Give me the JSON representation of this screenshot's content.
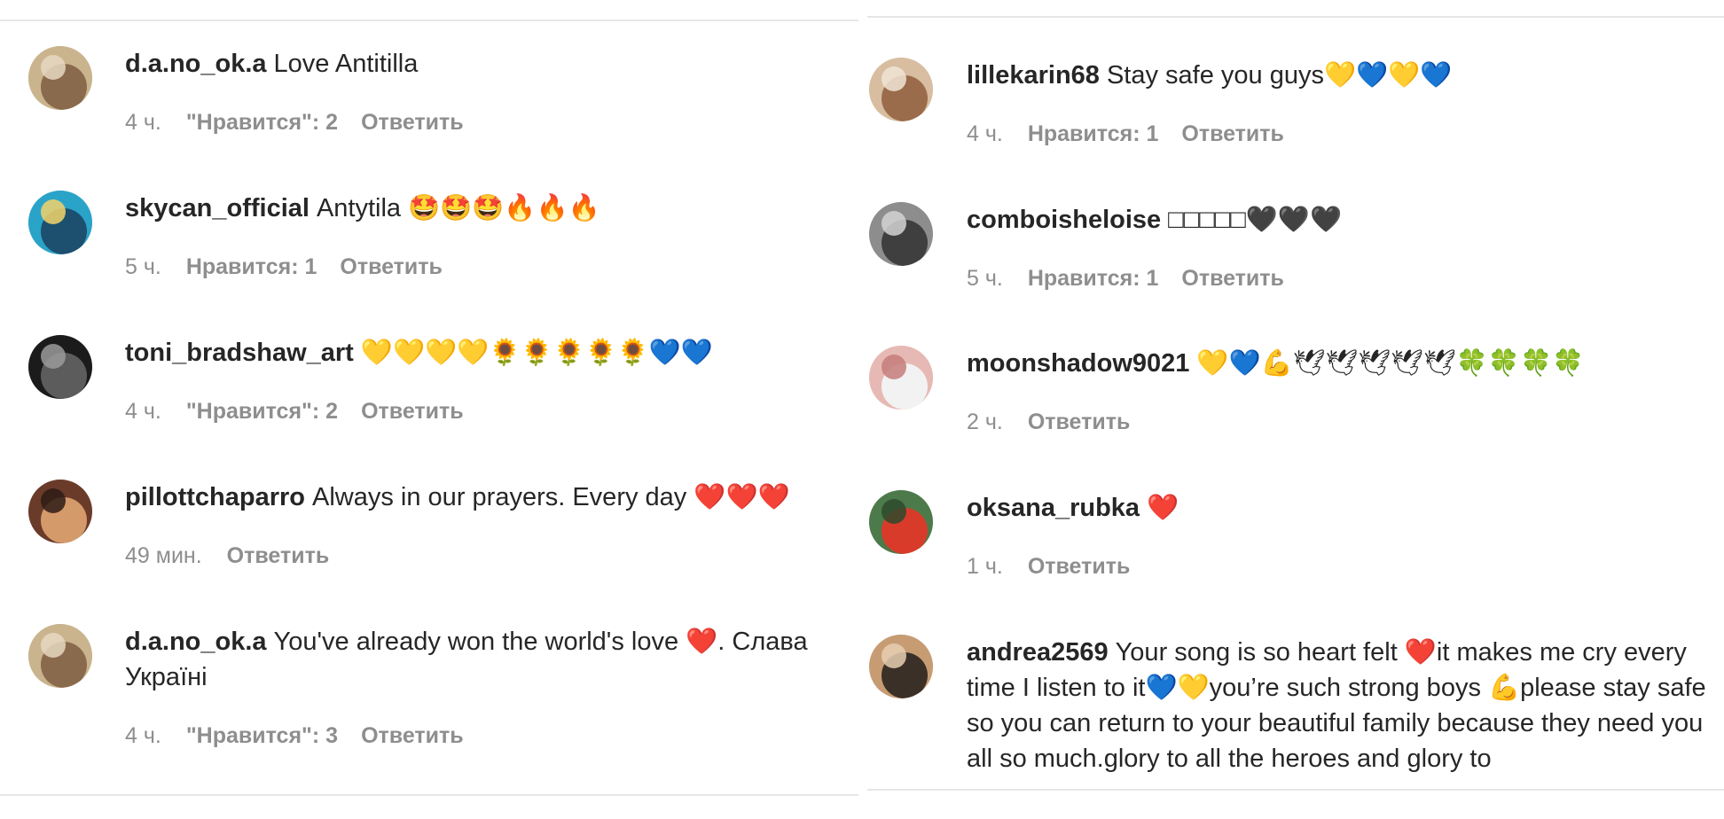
{
  "left": [
    {
      "username": "d.a.no_ok.a",
      "text": "Love Antitilla",
      "time": "4 ч.",
      "likes": "\"Нравится\": 2",
      "reply": "Ответить",
      "avatar_colors": [
        "#c9b48d",
        "#8a6a4d",
        "#e6d8c2"
      ]
    },
    {
      "username": "skycan_official",
      "text": "Antytila 🤩🤩🤩🔥🔥🔥",
      "time": "5 ч.",
      "likes": "Нравится: 1",
      "reply": "Ответить",
      "avatar_colors": [
        "#2aa3c8",
        "#1d4f6e",
        "#f2d36b"
      ]
    },
    {
      "username": "toni_bradshaw_art",
      "text": "💛💛💛💛🌻🌻🌻🌻🌻💙💙",
      "time": "4 ч.",
      "likes": "\"Нравится\": 2",
      "reply": "Ответить",
      "avatar_colors": [
        "#1b1b1b",
        "#5c5c5c",
        "#9a9a9a"
      ]
    },
    {
      "username": "pillottchaparro",
      "text": "Always in our prayers. Every day ❤️❤️❤️",
      "time": "49 мин.",
      "likes": "",
      "reply": "Ответить",
      "avatar_colors": [
        "#6b3b2a",
        "#d59a6a",
        "#2d1c15"
      ]
    },
    {
      "username": "d.a.no_ok.a",
      "text": "You've already won the world's love ❤️. Слава Україні",
      "time": "4 ч.",
      "likes": "\"Нравится\": 3",
      "reply": "Ответить",
      "avatar_colors": [
        "#c9b48d",
        "#8a6a4d",
        "#e6d8c2"
      ]
    }
  ],
  "right": [
    {
      "username": "lillekarin68",
      "text": "Stay safe you guys💛💙💛💙",
      "time": "4 ч.",
      "likes": "Нравится: 1",
      "reply": "Ответить",
      "avatar_colors": [
        "#d8bda0",
        "#9b6c4c",
        "#f1e5d6"
      ]
    },
    {
      "username": "comboisheloise",
      "text": "□□□□□🖤🖤🖤",
      "time": "5 ч.",
      "likes": "Нравится: 1",
      "reply": "Ответить",
      "avatar_colors": [
        "#8d8d8d",
        "#3f3f3f",
        "#d4d4d4"
      ]
    },
    {
      "username": "moonshadow9021",
      "text": "💛💙💪🕊🕊🕊🕊🕊🍀🍀🍀🍀",
      "time": "2 ч.",
      "likes": "",
      "reply": "Ответить",
      "avatar_colors": [
        "#e7b9b4",
        "#f2f2f2",
        "#c47d7a"
      ]
    },
    {
      "username": "oksana_rubka",
      "text": "❤️",
      "time": "1 ч.",
      "likes": "",
      "reply": "Ответить",
      "avatar_colors": [
        "#4d7a4a",
        "#d93b2b",
        "#2e4a2b"
      ]
    },
    {
      "username": "andrea2569",
      "text": "Your song is so heart felt ❤️it makes me cry every time I listen to it💙💛you’re such strong boys 💪please stay safe so you can return to your beautiful family because they need you all so much.glory to all the heroes and glory to",
      "time": "",
      "likes": "",
      "reply": "",
      "avatar_colors": [
        "#c79c73",
        "#3b3027",
        "#e6cfb3"
      ]
    }
  ]
}
